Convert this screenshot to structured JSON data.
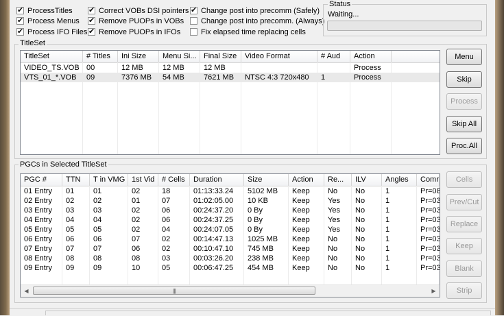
{
  "options": {
    "col1": [
      {
        "label": "ProcessTitles",
        "checked": true
      },
      {
        "label": "Process Menus",
        "checked": true
      },
      {
        "label": "Process IFO Files",
        "checked": true
      }
    ],
    "col2": [
      {
        "label": "Correct VOBs DSI pointers",
        "checked": true
      },
      {
        "label": "Remove PUOPs in VOBs",
        "checked": true
      },
      {
        "label": "Remove PUOPs in IFOs",
        "checked": true
      }
    ],
    "col3": [
      {
        "label": "Change post into precomm (Safely)",
        "checked": true
      },
      {
        "label": "Change post into precomm. (Always)",
        "checked": false
      },
      {
        "label": "Fix elapsed time replacing cells",
        "checked": false
      }
    ]
  },
  "status": {
    "title": "Status",
    "text": "Waiting..."
  },
  "titleset": {
    "title": "TitleSet",
    "columns": [
      "TitleSet",
      "# Titles",
      "Ini Size",
      "Menu Si...",
      "Final Size",
      "Video Format",
      "# Aud",
      "Action"
    ],
    "rows": [
      [
        "VIDEO_TS.VOB",
        "00",
        "12 MB",
        "12 MB",
        "12 MB",
        "",
        "",
        "Process"
      ],
      [
        "VTS_01_*.VOB",
        "09",
        "7376 MB",
        "54 MB",
        "7621 MB",
        "NTSC   4:3 720x480",
        "1",
        "Process"
      ]
    ],
    "buttons": [
      "Menu",
      "Skip",
      "Process",
      "Skip All",
      "Proc.All"
    ]
  },
  "pgcs": {
    "title": "PGCs in Selected TitleSet",
    "columns": [
      "PGC #",
      "TTN",
      "T in VMG",
      "1st Vid",
      "# Cells",
      "Duration",
      "Size",
      "Action",
      "Re...",
      "ILV",
      "Angles",
      "Comm"
    ],
    "rows": [
      [
        "01 Entry",
        "01",
        "01",
        "02",
        "18",
        "01:13:33.24",
        "5102 MB",
        "Keep",
        "No",
        "No",
        "1",
        "Pr=08"
      ],
      [
        "02 Entry",
        "02",
        "02",
        "01",
        "07",
        "01:02:05.00",
        "10 KB",
        "Keep",
        "Yes",
        "No",
        "1",
        "Pr=03"
      ],
      [
        "03 Entry",
        "03",
        "03",
        "02",
        "06",
        "00:24:37.20",
        "0 By",
        "Keep",
        "Yes",
        "No",
        "1",
        "Pr=03"
      ],
      [
        "04 Entry",
        "04",
        "04",
        "02",
        "06",
        "00:24:37.25",
        "0 By",
        "Keep",
        "Yes",
        "No",
        "1",
        "Pr=03"
      ],
      [
        "05 Entry",
        "05",
        "05",
        "02",
        "04",
        "00:24:07.05",
        "0 By",
        "Keep",
        "Yes",
        "No",
        "1",
        "Pr=03"
      ],
      [
        "06 Entry",
        "06",
        "06",
        "07",
        "02",
        "00:14:47.13",
        "1025 MB",
        "Keep",
        "No",
        "No",
        "1",
        "Pr=03"
      ],
      [
        "07 Entry",
        "07",
        "07",
        "06",
        "02",
        "00:10:47.10",
        "745 MB",
        "Keep",
        "No",
        "No",
        "1",
        "Pr=03"
      ],
      [
        "08 Entry",
        "08",
        "08",
        "08",
        "03",
        "00:03:26.20",
        "238 MB",
        "Keep",
        "No",
        "No",
        "1",
        "Pr=03"
      ],
      [
        "09 Entry",
        "09",
        "09",
        "10",
        "05",
        "00:06:47.25",
        "454 MB",
        "Keep",
        "No",
        "No",
        "1",
        "Pr=03"
      ]
    ],
    "buttons": [
      "Cells",
      "Prev/Cut",
      "Replace",
      "Keep",
      "Blank",
      "Strip"
    ]
  },
  "icons": {
    "scroll_left": "arrow-left-icon",
    "scroll_right": "arrow-right-icon",
    "scroll_grip": "grip-icon"
  }
}
